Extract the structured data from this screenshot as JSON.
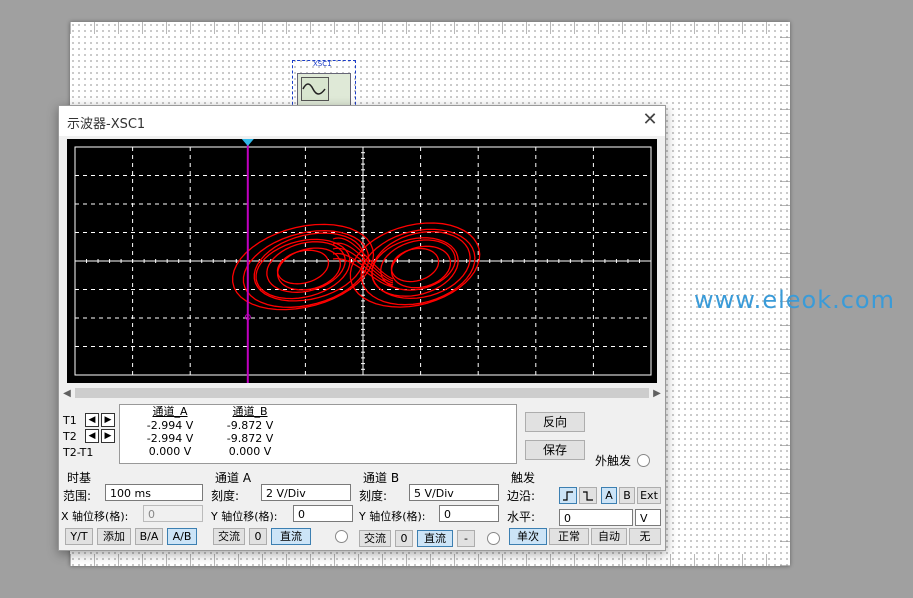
{
  "window": {
    "title": "示波器-XSC1",
    "close": "✕"
  },
  "component": {
    "label": "XSC1"
  },
  "watermark": "www.eleok.com",
  "cursors": {
    "t1_label": "T1",
    "t2_label": "T2",
    "diff_label": "T2-T1",
    "channel_a_header": "通道_A",
    "channel_b_header": "通道_B",
    "t1_a": "-2.994 V",
    "t1_b": "-9.872 V",
    "t2_a": "-2.994 V",
    "t2_b": "-9.872 V",
    "diff_a": "0.000 V",
    "diff_b": "0.000 V"
  },
  "buttons": {
    "reverse": "反向",
    "save": "保存",
    "external_trigger": "外触发"
  },
  "timebase": {
    "title": "时基",
    "scale_label": "范围:",
    "scale_value": "100 ms",
    "xpos_label": "X 轴位移(格):",
    "xpos_value": "0",
    "modes": [
      "Y/T",
      "添加",
      "B/A",
      "A/B"
    ],
    "active_mode": "A/B"
  },
  "channel_a": {
    "title": "通道 A",
    "scale_label": "刻度:",
    "scale_value": "2  V/Div",
    "ypos_label": "Y 轴位移(格):",
    "ypos_value": "0",
    "coupling": [
      "交流",
      "0",
      "直流"
    ],
    "active": "直流"
  },
  "channel_b": {
    "title": "通道 B",
    "scale_label": "刻度:",
    "scale_value": "5  V/Div",
    "ypos_label": "Y 轴位移(格):",
    "ypos_value": "0",
    "coupling": [
      "交流",
      "0",
      "直流",
      "-"
    ],
    "active": "直流"
  },
  "trigger": {
    "title": "触发",
    "edge_label": "边沿:",
    "sources": [
      "A",
      "B",
      "Ext"
    ],
    "active_source": "A",
    "level_label": "水平:",
    "level_value": "0",
    "level_unit": "V",
    "modes": [
      "单次",
      "正常",
      "自动",
      "无"
    ],
    "active_mode": "单次"
  },
  "colors": {
    "trace": "#ff0000",
    "cursor": "#c000c0",
    "grid": "#ffffff",
    "screen": "#000000"
  }
}
